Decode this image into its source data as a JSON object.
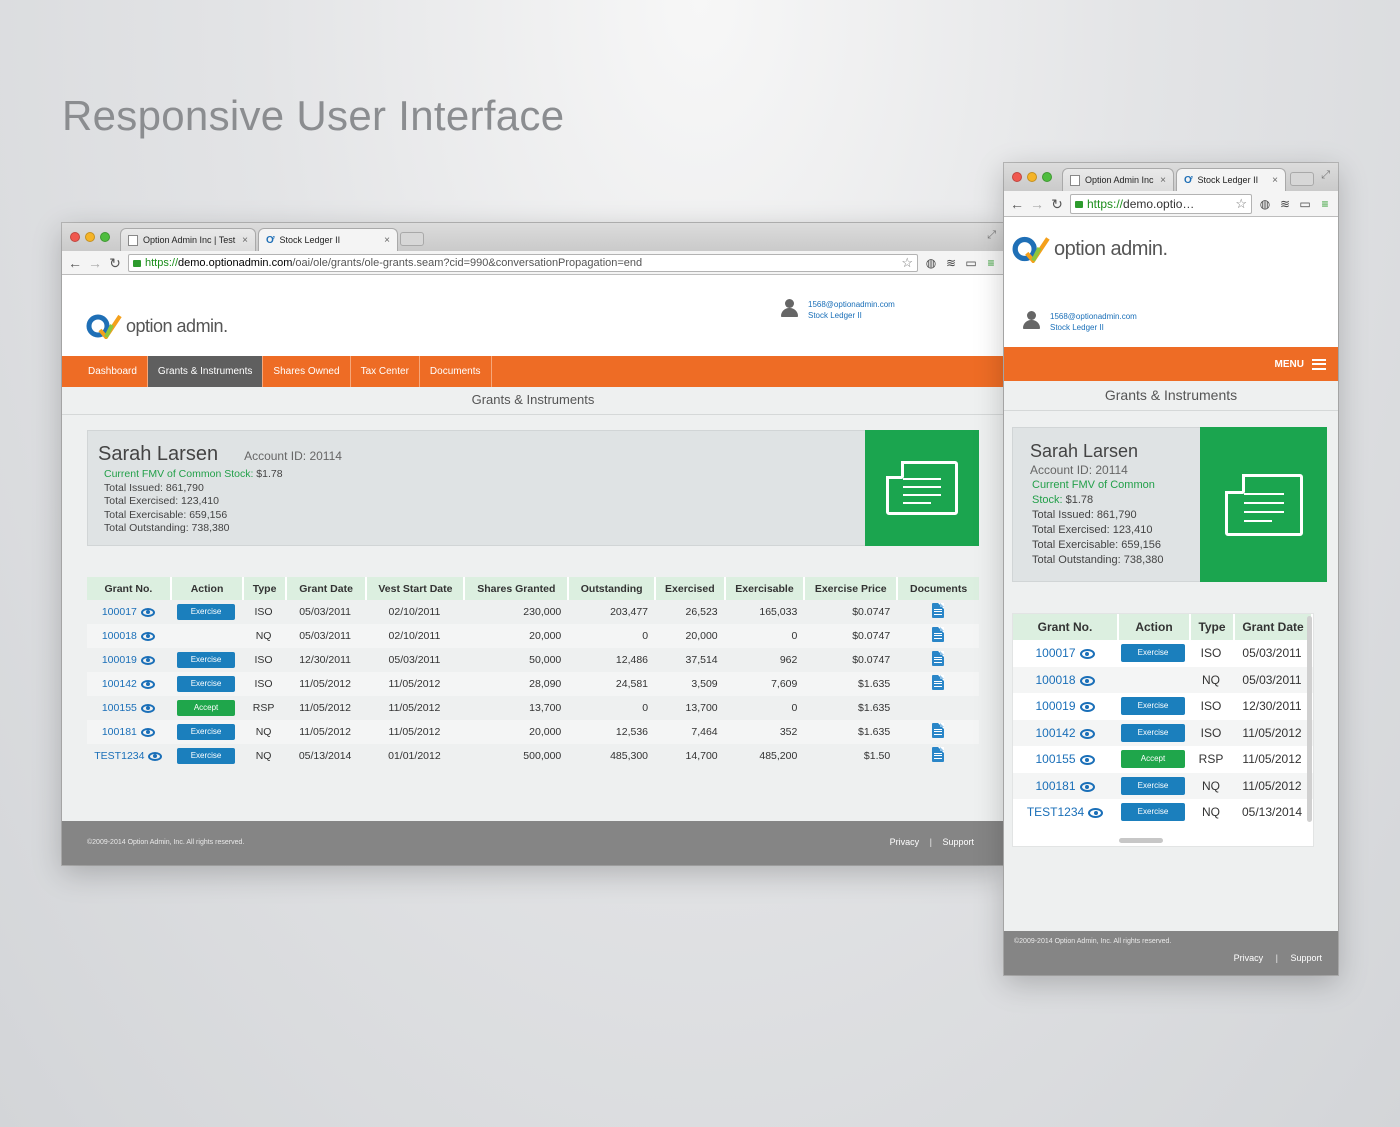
{
  "heading": "Responsive User Interface",
  "desktop": {
    "tabs": [
      {
        "label": "Option Admin Inc | Test"
      },
      {
        "label": "Stock Ledger II"
      }
    ],
    "url": {
      "scheme": "https://",
      "host": "demo.optionadmin.com",
      "path": "/oai/ole/grants/ole-grants.seam?cid=990&conversationPropagation=end"
    }
  },
  "mobile": {
    "tabs": [
      {
        "label": "Option Admin Inc"
      },
      {
        "label": "Stock Ledger II"
      }
    ],
    "url": {
      "scheme": "https://",
      "host": "demo.optio…"
    },
    "menu_label": "MENU"
  },
  "site": {
    "logo_text": "option admin.",
    "user_email": "1568@optionadmin.com",
    "user_ledger": "Stock Ledger II",
    "nav": [
      "Dashboard",
      "Grants & Instruments",
      "Shares Owned",
      "Tax Center",
      "Documents"
    ],
    "active_nav": "Grants & Instruments",
    "section_title": "Grants & Instruments",
    "summary": {
      "name": "Sarah Larsen",
      "account": "Account ID: 20114",
      "fmv_label": "Current FMV of Common Stock:",
      "fmv_value": "$1.78",
      "fmv_label_m1": "Current FMV of Common",
      "fmv_label_m2": "Stock:",
      "issued": "Total Issued:  861,790",
      "exercised": "Total Exercised: 123,410",
      "exercisable": "Total Exercisable: 659,156",
      "outstanding": "Total Outstanding: 738,380"
    },
    "table": {
      "headers": [
        "Grant No.",
        "Action",
        "Type",
        "Grant Date",
        "Vest Start Date",
        "Shares Granted",
        "Outstanding",
        "Exercised",
        "Exercisable",
        "Exercise Price",
        "Documents"
      ],
      "rows": [
        {
          "id": "100017",
          "action": "Exercise",
          "type": "ISO",
          "grant_date": "05/03/2011",
          "vest": "02/10/2011",
          "granted": "230,000",
          "outstanding": "203,477",
          "exercised": "26,523",
          "exercisable": "165,033",
          "price": "$0.0747",
          "doc": true
        },
        {
          "id": "100018",
          "action": "",
          "type": "NQ",
          "grant_date": "05/03/2011",
          "vest": "02/10/2011",
          "granted": "20,000",
          "outstanding": "0",
          "exercised": "20,000",
          "exercisable": "0",
          "price": "$0.0747",
          "doc": true
        },
        {
          "id": "100019",
          "action": "Exercise",
          "type": "ISO",
          "grant_date": "12/30/2011",
          "vest": "05/03/2011",
          "granted": "50,000",
          "outstanding": "12,486",
          "exercised": "37,514",
          "exercisable": "962",
          "price": "$0.0747",
          "doc": true
        },
        {
          "id": "100142",
          "action": "Exercise",
          "type": "ISO",
          "grant_date": "11/05/2012",
          "vest": "11/05/2012",
          "granted": "28,090",
          "outstanding": "24,581",
          "exercised": "3,509",
          "exercisable": "7,609",
          "price": "$1.635",
          "doc": true
        },
        {
          "id": "100155",
          "action": "Accept",
          "type": "RSP",
          "grant_date": "11/05/2012",
          "vest": "11/05/2012",
          "granted": "13,700",
          "outstanding": "0",
          "exercised": "13,700",
          "exercisable": "0",
          "price": "$1.635",
          "doc": false
        },
        {
          "id": "100181",
          "action": "Exercise",
          "type": "NQ",
          "grant_date": "11/05/2012",
          "vest": "11/05/2012",
          "granted": "20,000",
          "outstanding": "12,536",
          "exercised": "7,464",
          "exercisable": "352",
          "price": "$1.635",
          "doc": true
        },
        {
          "id": "TEST1234",
          "action": "Exercise",
          "type": "NQ",
          "grant_date": "05/13/2014",
          "vest": "01/01/2012",
          "granted": "500,000",
          "outstanding": "485,300",
          "exercised": "14,700",
          "exercisable": "485,200",
          "price": "$1.50",
          "doc": true
        }
      ]
    },
    "footer": {
      "copyright": "©2009-2014 Option Admin, Inc. All rights reserved.",
      "privacy": "Privacy",
      "sep": "|",
      "support": "Support"
    }
  },
  "colors": {
    "accent": "#ee6c25",
    "green": "#1ba54f",
    "link": "#1a6fb8",
    "button_blue": "#1b7fbd"
  }
}
